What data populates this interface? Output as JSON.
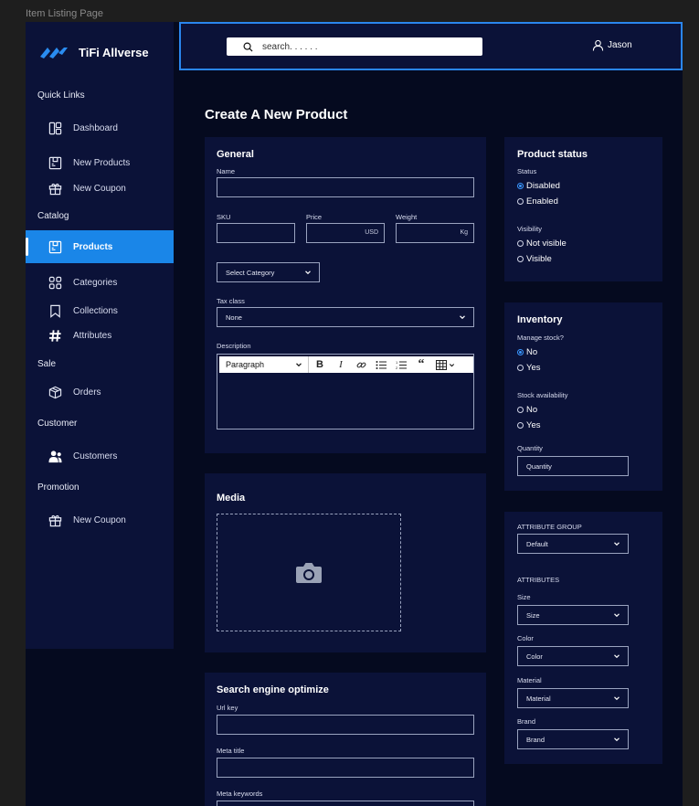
{
  "frame_label": "Item Listing Page",
  "brand": {
    "name": "TiFi Allverse",
    "accent": "#1a86e8"
  },
  "header": {
    "search_placeholder": "search. . . . . .",
    "user": "Jason"
  },
  "sidebar": {
    "sections": {
      "quick_links": "Quick Links",
      "catalog": "Catalog",
      "sale": "Sale",
      "customer": "Customer",
      "promotion": "Promotion"
    },
    "items": [
      {
        "label": "Dashboard",
        "icon": "dashboard-icon"
      },
      {
        "label": "New Products",
        "icon": "product-box-icon"
      },
      {
        "label": "New Coupon",
        "icon": "gift-icon"
      },
      {
        "label": "Products",
        "icon": "product-box-icon",
        "active": true
      },
      {
        "label": "Categories",
        "icon": "grid-icon"
      },
      {
        "label": "Collections",
        "icon": "bookmark-icon"
      },
      {
        "label": "Attributes",
        "icon": "hashtag-icon"
      },
      {
        "label": "Orders",
        "icon": "package-icon"
      },
      {
        "label": "Customers",
        "icon": "users-icon"
      },
      {
        "label": "New Coupon",
        "icon": "gift-icon"
      }
    ]
  },
  "page_title": "Create A New Product",
  "general": {
    "title": "General",
    "name_label": "Name",
    "sku_label": "SKU",
    "price_label": "Price",
    "price_unit": "USD",
    "weight_label": "Weight",
    "weight_unit": "Kg",
    "category_select": "Select Category",
    "tax_label": "Tax class",
    "tax_value": "None",
    "description_label": "Description",
    "editor_paragraph": "Paragraph"
  },
  "media": {
    "title": "Media"
  },
  "seo": {
    "title": "Search engine optimize",
    "url_key": "Url key",
    "meta_title": "Meta title",
    "meta_keywords": "Meta keywords"
  },
  "status": {
    "title": "Product status",
    "status_label": "Status",
    "disabled": "Disabled",
    "enabled": "Enabled",
    "visibility_label": "Visibility",
    "not_visible": "Not visible",
    "visible": "Visible"
  },
  "inventory": {
    "title": "Inventory",
    "manage_label": "Manage stock?",
    "manage_no": "No",
    "manage_yes": "Yes",
    "availability_label": "Stock availability",
    "avail_no": "No",
    "avail_yes": "Yes",
    "quantity_label": "Quantity",
    "quantity_placeholder": "Quantity"
  },
  "attributes": {
    "group_label": "ATTRIBUTE GROUP",
    "group_value": "Default",
    "attributes_label": "ATTRIBUTES",
    "size_label": "Size",
    "size_value": "Size",
    "color_label": "Color",
    "color_value": "Color",
    "material_label": "Material",
    "material_value": "Material",
    "brand_label": "Brand",
    "brand_value": "Brand"
  }
}
